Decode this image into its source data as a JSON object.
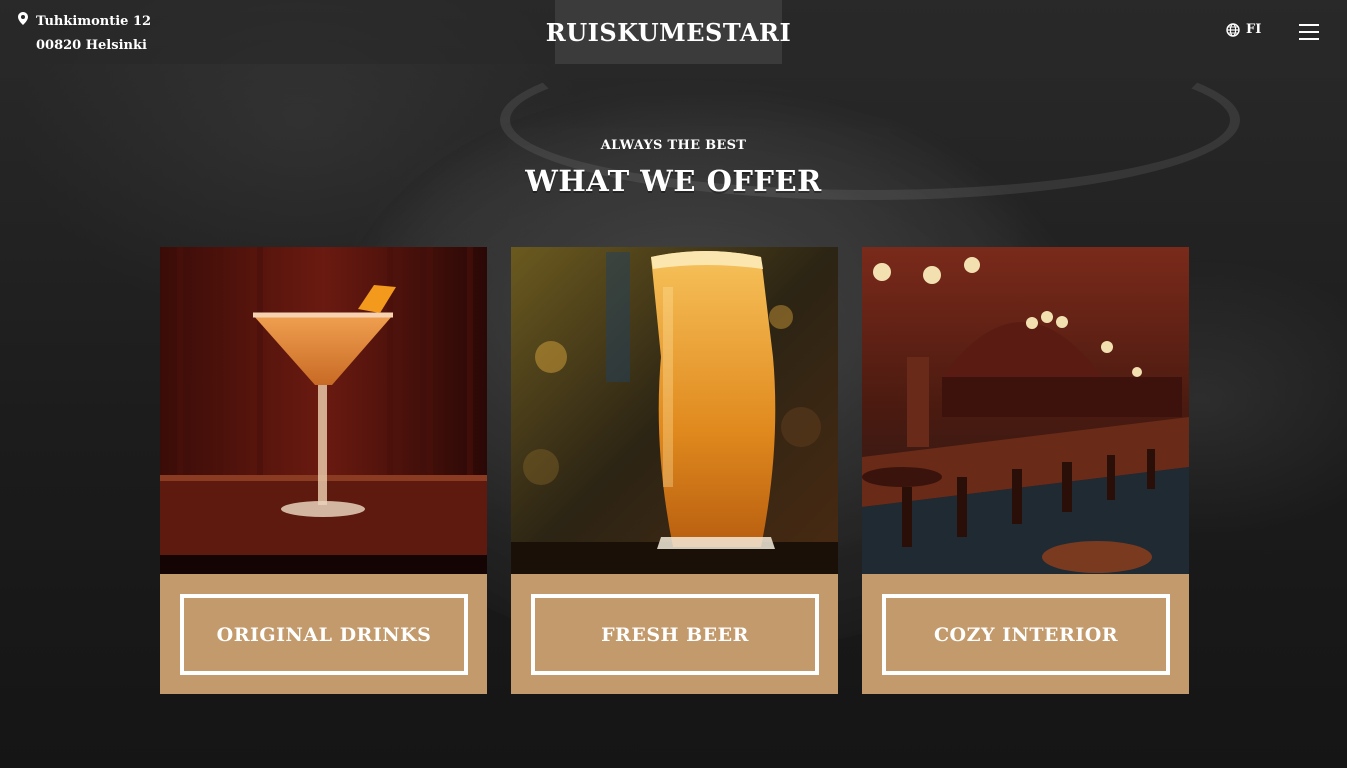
{
  "header": {
    "address_line1": "Tuhkimontie 12",
    "address_line2": "00820 Helsinki",
    "logo": "RUISKUMESTARI",
    "language": "FI",
    "icons": [
      "location-pin-icon",
      "globe-icon",
      "hamburger-menu-icon"
    ]
  },
  "section": {
    "eyebrow": "ALWAYS THE BEST",
    "title": "WHAT WE OFFER"
  },
  "cards": [
    {
      "label": "ORIGINAL DRINKS",
      "image": "cocktail-glass-photo"
    },
    {
      "label": "FRESH BEER",
      "image": "beer-pint-photo"
    },
    {
      "label": "COZY INTERIOR",
      "image": "bar-interior-photo"
    }
  ],
  "colors": {
    "card_accent": "#c29a6c",
    "background": "#1c1c1c",
    "text": "#ffffff"
  }
}
